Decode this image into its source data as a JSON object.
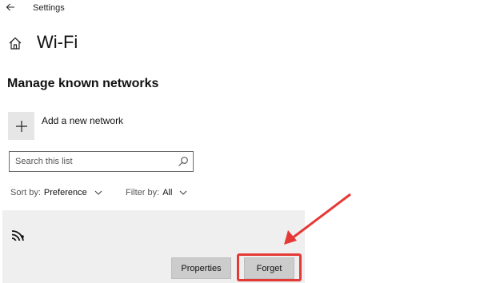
{
  "titlebar": {
    "title": "Settings",
    "back_icon": "back-arrow-icon"
  },
  "header": {
    "title": "Wi-Fi",
    "home_icon": "home-icon"
  },
  "section": {
    "title": "Manage known networks"
  },
  "add_network": {
    "label": "Add a new network",
    "icon": "plus-icon"
  },
  "search": {
    "placeholder": "Search this list",
    "value": "",
    "icon": "search-icon"
  },
  "sort": {
    "label": "Sort by:",
    "value": "Preference"
  },
  "filter": {
    "label": "Filter by:",
    "value": "All"
  },
  "network": {
    "icon": "wifi-icon"
  },
  "buttons": {
    "properties": "Properties",
    "forget": "Forget"
  },
  "colors": {
    "highlight": "#e53935",
    "panel": "#efefef",
    "button": "#cccccc"
  }
}
